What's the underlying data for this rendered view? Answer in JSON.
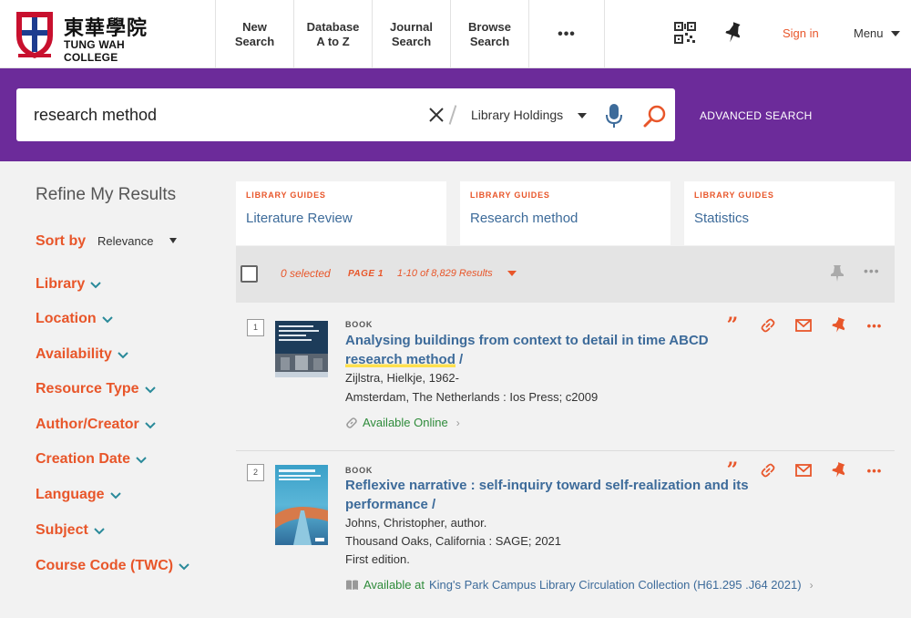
{
  "brand": {
    "name_zh": "東華學院",
    "name_en": "TUNG WAH COLLEGE"
  },
  "nav": {
    "items": [
      "New\nSearch",
      "Database\nA to Z",
      "Journal\nSearch",
      "Browse\nSearch",
      "•••"
    ],
    "sign_in": "Sign in",
    "menu": "Menu"
  },
  "search": {
    "query": "research method",
    "scope": "Library Holdings",
    "advanced": "ADVANCED SEARCH"
  },
  "sidebar": {
    "title": "Refine My Results",
    "sort_label": "Sort by",
    "sort_value": "Relevance",
    "facets": [
      "Library",
      "Location",
      "Availability",
      "Resource Type",
      "Author/Creator",
      "Creation Date",
      "Language",
      "Subject",
      "Course Code (TWC)"
    ]
  },
  "guides": [
    {
      "tag": "LIBRARY GUIDES",
      "title": "Literature Review"
    },
    {
      "tag": "LIBRARY GUIDES",
      "title": "Research method"
    },
    {
      "tag": "LIBRARY GUIDES",
      "title": "Statistics"
    }
  ],
  "toolbar": {
    "selected": "0 selected",
    "page": "PAGE 1",
    "range": "1-10 of 8,829 Results",
    "more": "•••"
  },
  "results": [
    {
      "number": "1",
      "type": "BOOK",
      "title_pre": "Analysing buildings from context to detail in time ABCD ",
      "title_hl": "research method",
      "title_post": " /",
      "author": "Zijlstra, Hielkje, 1962-",
      "publisher": "Amsterdam, The Netherlands : Ios Press; c2009",
      "edition": "",
      "availability": "Available Online",
      "location": "",
      "more": "•••",
      "colors": {
        "thumb": "#1d3c5a"
      }
    },
    {
      "number": "2",
      "type": "BOOK",
      "title_pre": "Reflexive narrative : self-inquiry toward self-realization and its performance /",
      "title_hl": "",
      "title_post": "",
      "author": "Johns, Christopher, author.",
      "publisher": "Thousand Oaks, California : SAGE; 2021",
      "edition": "First edition.",
      "availability": "Available at",
      "location": "King's Park Campus Library  Circulation Collection (H61.295 .J64 2021)",
      "more": "•••",
      "colors": {
        "thumb": "#3aa0c8"
      }
    }
  ],
  "colors": {
    "accent": "#e8562a",
    "purple": "#6c2b9a",
    "link": "#3d6b9a",
    "available": "#2e8b3a"
  }
}
